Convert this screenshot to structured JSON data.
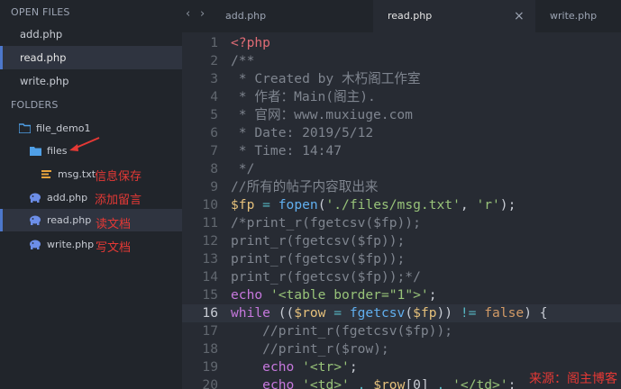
{
  "sidebar": {
    "open_files_header": "OPEN FILES",
    "open_files": [
      {
        "label": "add.php",
        "active": false
      },
      {
        "label": "read.php",
        "active": true
      },
      {
        "label": "write.php",
        "active": false
      }
    ],
    "folders_header": "FOLDERS",
    "tree": [
      {
        "label": "file_demo1",
        "icon": "folder-open-icon"
      },
      {
        "label": "files",
        "icon": "folder-icon"
      },
      {
        "label": "msg.txt",
        "icon": "text-file-icon"
      },
      {
        "label": "add.php",
        "icon": "php-elephant-icon"
      },
      {
        "label": "read.php",
        "icon": "php-elephant-icon"
      },
      {
        "label": "write.php",
        "icon": "php-elephant-icon"
      }
    ],
    "notes": [
      "信息保存",
      "添加留言",
      "读文档",
      "写文档"
    ]
  },
  "tabs": [
    {
      "label": "add.php",
      "active": false
    },
    {
      "label": "read.php",
      "active": true
    },
    {
      "label": "write.php",
      "active": false
    }
  ],
  "tab_close": "×",
  "nav": {
    "back": "‹",
    "forward": "›"
  },
  "editor": {
    "current_line": 16,
    "lines": [
      {
        "n": "1",
        "t": "<?php"
      },
      {
        "n": "2",
        "t": "/**"
      },
      {
        "n": "3",
        "t": " * Created by 木朽阁工作室"
      },
      {
        "n": "4",
        "t": " * 作者：Main(阁主)."
      },
      {
        "n": "5",
        "t": " * 官网：www.muxiuge.com"
      },
      {
        "n": "6",
        "t": " * Date: 2019/5/12"
      },
      {
        "n": "7",
        "t": " * Time: 14:47"
      },
      {
        "n": "8",
        "t": " */"
      },
      {
        "n": "9",
        "t": "//所有的帖子内容取出来"
      },
      {
        "n": "10",
        "t": "$fp = fopen('./files/msg.txt', 'r');"
      },
      {
        "n": "11",
        "t": "/*print_r(fgetcsv($fp));"
      },
      {
        "n": "12",
        "t": "print_r(fgetcsv($fp));"
      },
      {
        "n": "13",
        "t": "print_r(fgetcsv($fp));"
      },
      {
        "n": "14",
        "t": "print_r(fgetcsv($fp));*/"
      },
      {
        "n": "15",
        "t": "echo '<table border=\"1\">';"
      },
      {
        "n": "16",
        "t": "while (($row = fgetcsv($fp)) != false) {"
      },
      {
        "n": "17",
        "t": "    //print_r(fgetcsv($fp));"
      },
      {
        "n": "18",
        "t": "    //print_r($row);"
      },
      {
        "n": "19",
        "t": "    echo '<tr>';"
      },
      {
        "n": "20",
        "t": "    echo '<td>' . $row[0] . '</td>';"
      }
    ]
  },
  "watermark": "来源：阁主博客",
  "colors": {
    "sidebar_bg": "#21252b",
    "editor_bg": "#272b33",
    "active_border": "#4d78cc",
    "annotation_red": "#e53935",
    "php_icon_blue": "#6c8ee8",
    "folder_blue": "#4f9fe6",
    "txt_icon_orange": "#e8a33c"
  }
}
